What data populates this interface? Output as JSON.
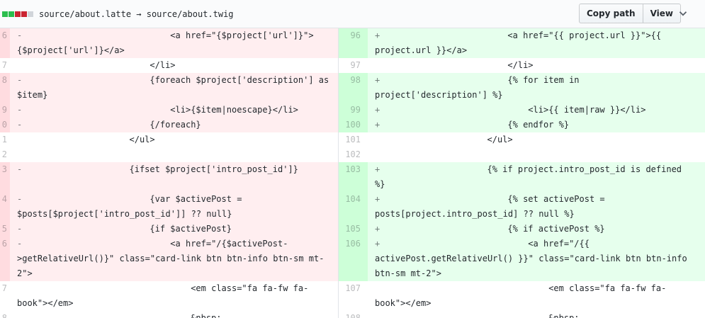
{
  "header": {
    "file_path": "source/about.latte → source/about.twig",
    "diffstat_colors": [
      "#2cbe4e",
      "#2cbe4e",
      "#cb2431",
      "#cb2431",
      "#d1d5da"
    ],
    "copy_path_label": "Copy path",
    "view_label": "View",
    "menu_icon": "chevron-down-icon"
  },
  "colors": {
    "deletion_bg": "#ffeef0",
    "deletion_num_bg": "#ffdce0",
    "addition_bg": "#e6ffed",
    "addition_num_bg": "#cdffd8"
  },
  "rows": [
    {
      "left_type": "del",
      "left_num": "6",
      "left_text": "                            <a href=\"{$project['url']}\">\n{$project['url']}</a>",
      "right_type": "add",
      "right_num": "96",
      "right_text": "                        <a href=\"{{ project.url }}\">{{\nproject.url }}</a>"
    },
    {
      "left_type": "ctx",
      "left_num": "7",
      "left_text": "                        </li>",
      "right_type": "ctx",
      "right_num": "97",
      "right_text": "                        </li>"
    },
    {
      "left_type": "del",
      "left_num": "8",
      "left_text": "                        {foreach $project['description'] as\n$item}",
      "right_type": "add",
      "right_num": "98",
      "right_text": "                        {% for item in\nproject['description'] %}"
    },
    {
      "left_type": "del",
      "left_num": "9",
      "left_text": "                            <li>{$item|noescape}</li>",
      "right_type": "add",
      "right_num": "99",
      "right_text": "                            <li>{{ item|raw }}</li>"
    },
    {
      "left_type": "del",
      "left_num": "0",
      "left_text": "                        {/foreach}",
      "right_type": "add",
      "right_num": "100",
      "right_text": "                        {% endfor %}"
    },
    {
      "left_type": "ctx",
      "left_num": "1",
      "left_text": "                    </ul>",
      "right_type": "ctx",
      "right_num": "101",
      "right_text": "                    </ul>"
    },
    {
      "left_type": "ctx",
      "left_num": "2",
      "left_text": "",
      "right_type": "ctx",
      "right_num": "102",
      "right_text": ""
    },
    {
      "left_type": "del",
      "left_num": "3",
      "left_text": "                    {ifset $project['intro_post_id']}\n",
      "right_type": "add",
      "right_num": "103",
      "right_text": "                    {% if project.intro_post_id is defined\n%}"
    },
    {
      "left_type": "del",
      "left_num": "4",
      "left_text": "                        {var $activePost =\n$posts[$project['intro_post_id']] ?? null}",
      "right_type": "add",
      "right_num": "104",
      "right_text": "                        {% set activePost =\nposts[project.intro_post_id] ?? null %}"
    },
    {
      "left_type": "del",
      "left_num": "5",
      "left_text": "                        {if $activePost}",
      "right_type": "add",
      "right_num": "105",
      "right_text": "                        {% if activePost %}"
    },
    {
      "left_type": "del",
      "left_num": "6",
      "left_text": "                            <a href=\"/{$activePost-\n>getRelativeUrl()}\" class=\"card-link btn btn-info btn-sm mt-\n2\">",
      "right_type": "add",
      "right_num": "106",
      "right_text": "                            <a href=\"/{{\nactivePost.getRelativeUrl() }}\" class=\"card-link btn btn-info\nbtn-sm mt-2\">"
    },
    {
      "left_type": "ctx",
      "left_num": "7",
      "left_text": "                                <em class=\"fa fa-fw fa-\nbook\"></em>",
      "right_type": "ctx",
      "right_num": "107",
      "right_text": "                                <em class=\"fa fa-fw fa-\nbook\"></em>"
    },
    {
      "left_type": "ctx",
      "left_num": "8",
      "left_text": "                                &nbsp;",
      "right_type": "ctx",
      "right_num": "108",
      "right_text": "                                &nbsp;"
    }
  ]
}
